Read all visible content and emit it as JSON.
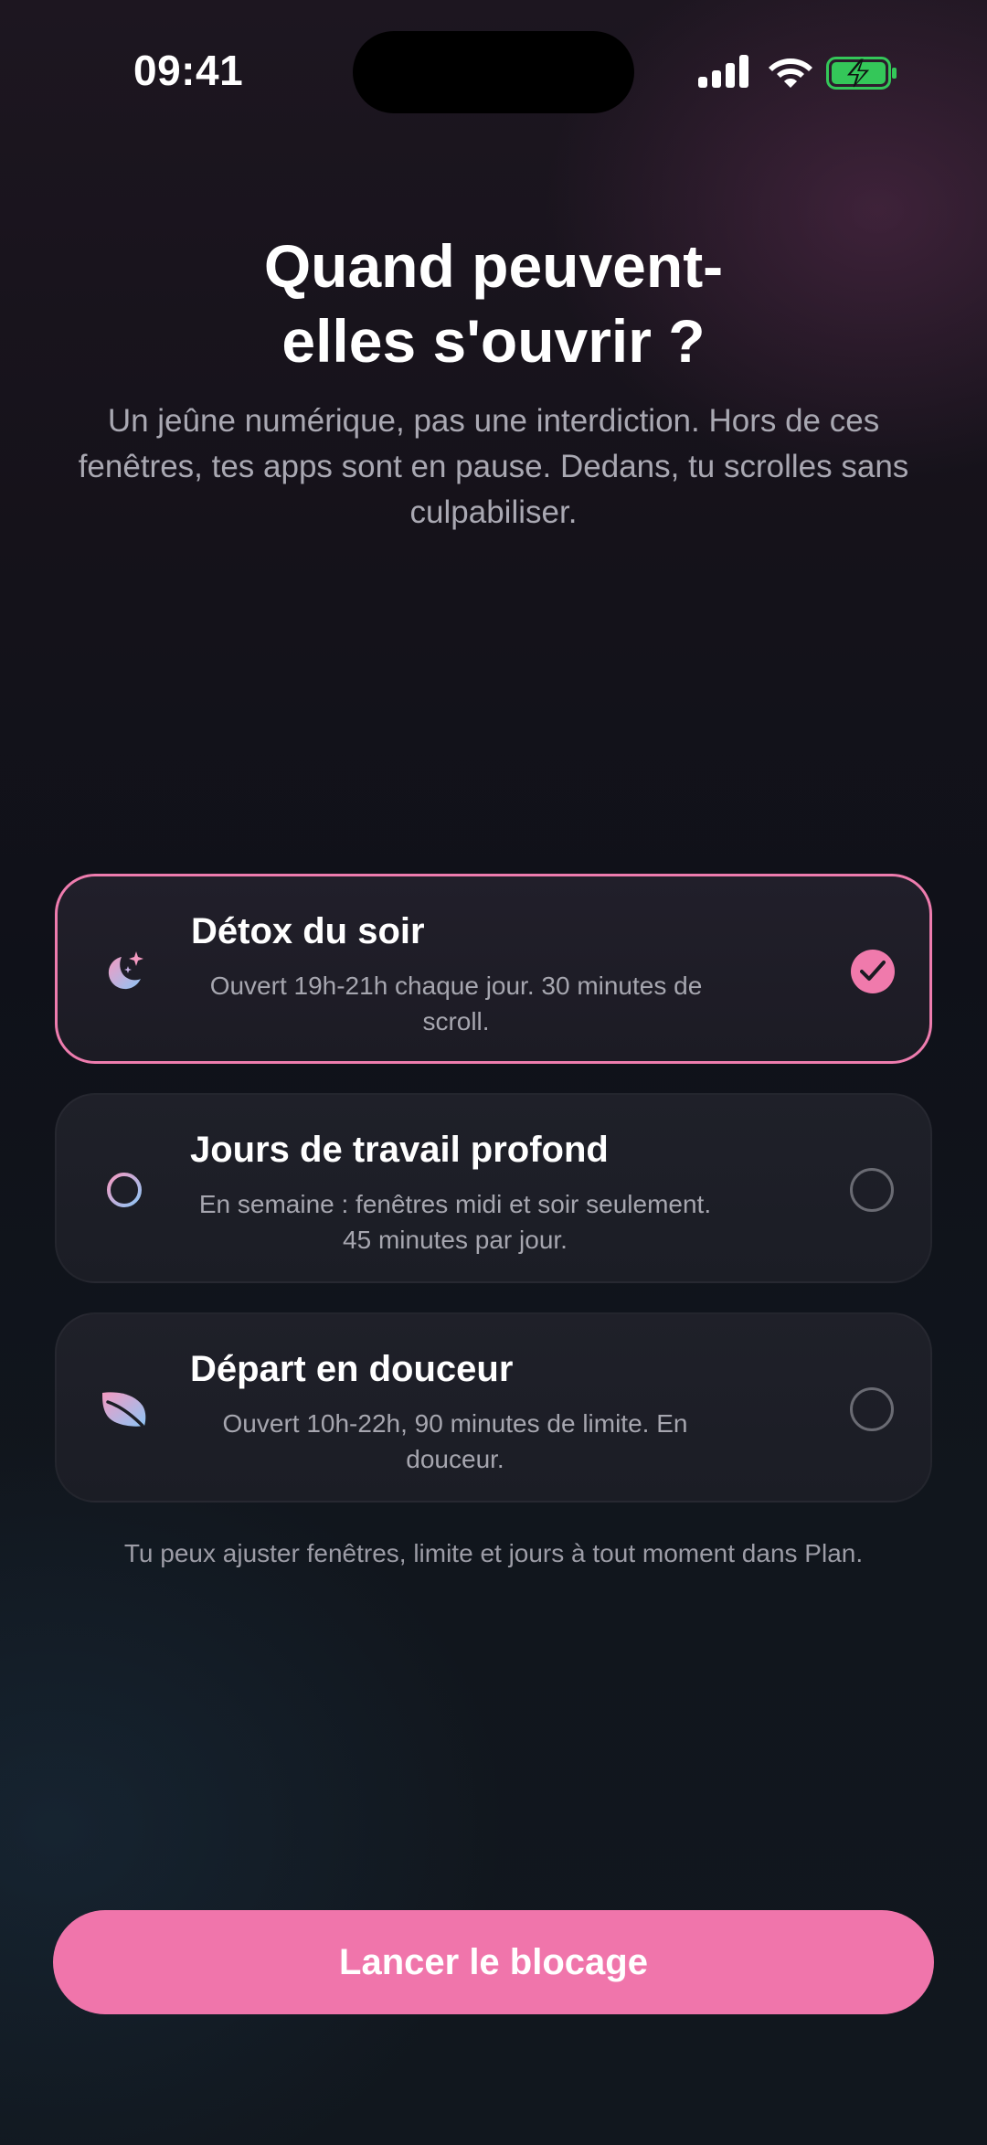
{
  "status_bar": {
    "time": "09:41",
    "icons": [
      "signal-icon",
      "wifi-icon",
      "battery-charging-icon"
    ]
  },
  "header": {
    "title_line1": "Quand peuvent-",
    "title_line2": "elles s'ouvrir ?",
    "subtitle": "Un jeûne numérique, pas une interdiction. Hors de ces fenêtres, tes apps sont en pause. Dedans, tu scrolles sans culpabiliser."
  },
  "options": [
    {
      "title": "Détox du soir",
      "description": "Ouvert 19h-21h chaque jour. 30 minutes de scroll.",
      "icon": "moon-stars-icon",
      "selected": true
    },
    {
      "title": "Jours de travail profond",
      "description": "En semaine : fenêtres midi et soir seulement. 45 minutes par jour.",
      "icon": "crosshair-icon",
      "selected": false
    },
    {
      "title": "Départ en douceur",
      "description": "Ouvert 10h-22h, 90 minutes de limite. En douceur.",
      "icon": "leaf-icon",
      "selected": false
    }
  ],
  "footnote": "Tu peux ajuster fenêtres, limite et jours à tout moment dans Plan.",
  "cta": {
    "label": "Lancer le blocage"
  },
  "colors": {
    "accent_pink": "#f075ab",
    "battery_green": "#34c759",
    "icon_gradient_start": "#f49ac1",
    "icon_gradient_end": "#8ec5f5"
  }
}
